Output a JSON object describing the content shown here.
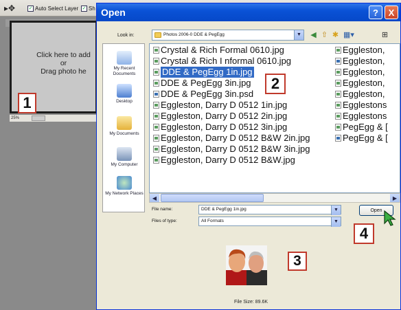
{
  "app": {
    "toolbar": {
      "move_icon": "move-tool-icon",
      "auto_select_label": "Auto Select Layer",
      "show_label": "Sh"
    },
    "document": {
      "lines": [
        "Click here to add",
        "or",
        "Drag photo he"
      ],
      "zoom": "25%"
    }
  },
  "dialog": {
    "title": "Open",
    "help_label": "?",
    "close_label": "X",
    "look_in_label": "Look in:",
    "look_in_value": "Photos 2006-0 DDE & PegEgg",
    "places": [
      "My Recent Documents",
      "Desktop",
      "My Documents",
      "My Computer",
      "My Network Places"
    ],
    "files_col1": [
      {
        "name": "Crystal & Rich Formal 0610.jpg",
        "type": "jpg"
      },
      {
        "name": "Crystal & Rich I nformal 0610.jpg",
        "type": "jpg"
      },
      {
        "name": "DDE & PegEgg 1in.jpg",
        "type": "jpg",
        "selected": true
      },
      {
        "name": "DDE & PegEgg 3in.jpg",
        "type": "jpg"
      },
      {
        "name": "DDE & PegEgg 3in.psd",
        "type": "psd"
      },
      {
        "name": "Eggleston, Darry D 0512 1in.jpg",
        "type": "jpg"
      },
      {
        "name": "Eggleston, Darry D 0512 2in.jpg",
        "type": "jpg"
      },
      {
        "name": "Eggleston, Darry D 0512 3in.jpg",
        "type": "jpg"
      },
      {
        "name": "Eggleston, Darry D 0512 B&W 2in.jpg",
        "type": "jpg"
      },
      {
        "name": "Eggleston, Darry D 0512 B&W 3in.jpg",
        "type": "jpg"
      },
      {
        "name": "Eggleston, Darry D 0512 B&W.jpg",
        "type": "jpg"
      }
    ],
    "files_col2": [
      {
        "name": "Eggleston,",
        "type": "jpg"
      },
      {
        "name": "Eggleston,",
        "type": "psd"
      },
      {
        "name": "Eggleston,",
        "type": "jpg"
      },
      {
        "name": "Eggleston,",
        "type": "jpg"
      },
      {
        "name": "Eggleston,",
        "type": "jpg"
      },
      {
        "name": "Egglestons",
        "type": "jpg"
      },
      {
        "name": "Egglestons",
        "type": "jpg"
      },
      {
        "name": "PegEgg & [",
        "type": "jpg"
      },
      {
        "name": "PegEgg & [",
        "type": "psd"
      }
    ],
    "file_name_label": "File name:",
    "file_name_value": "DDE & PegEgg 1in.jpg",
    "files_of_type_label": "Files of type:",
    "files_of_type_value": "All Formats",
    "open_button": "Open",
    "file_size": "File Size: 89.6K"
  },
  "callouts": [
    "1",
    "2",
    "3",
    "4"
  ],
  "colors": {
    "titlebar": "#0a52d6",
    "selection": "#316ac5",
    "callout_border": "#c0392b"
  }
}
